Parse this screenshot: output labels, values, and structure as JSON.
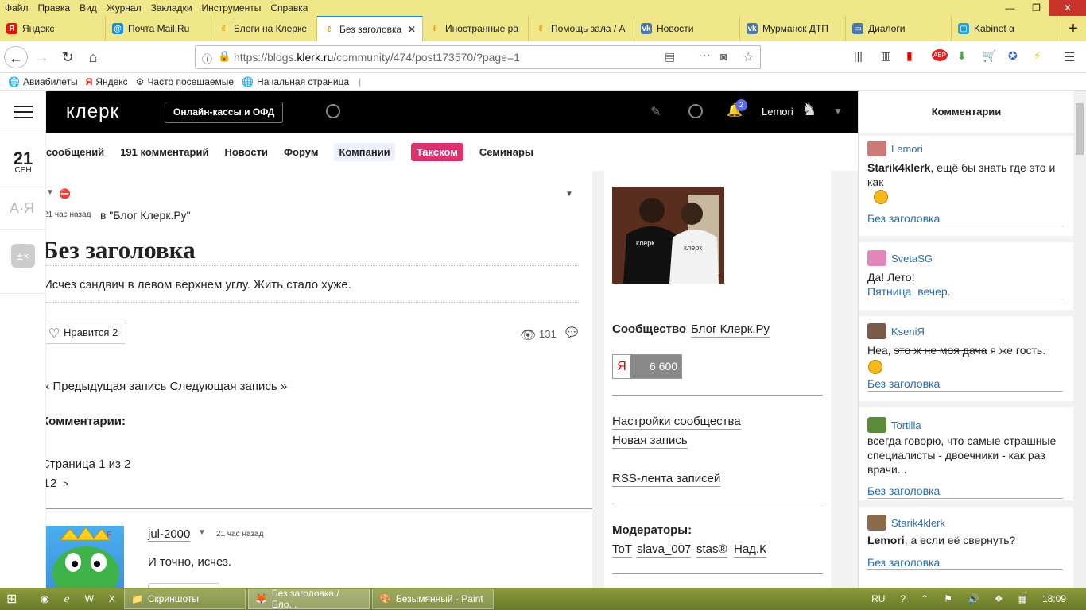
{
  "menubar": [
    "Файл",
    "Правка",
    "Вид",
    "Журнал",
    "Закладки",
    "Инструменты",
    "Справка"
  ],
  "window_controls": [
    "—",
    "❐",
    "✕"
  ],
  "tabs": [
    {
      "label": "Яндекс",
      "icon": "yandex-icon",
      "color": "#e61400"
    },
    {
      "label": "Почта Mail.Ru",
      "icon": "mail-icon",
      "color": "#168de2"
    },
    {
      "label": "Блоги на Клерке",
      "icon": "klerk-icon",
      "color": "#e8a21a"
    },
    {
      "label": "Без заголовка",
      "icon": "klerk-icon",
      "color": "#e8a21a"
    },
    {
      "label": "Иностранные ра",
      "icon": "klerk-icon",
      "color": "#e8a21a"
    },
    {
      "label": "Помощь зала / А",
      "icon": "klerk-icon",
      "color": "#e8a21a"
    },
    {
      "label": "Новости",
      "icon": "vk-icon",
      "color": "#4a76a8"
    },
    {
      "label": "Мурманск ДТП",
      "icon": "vk-icon",
      "color": "#4a76a8"
    },
    {
      "label": "Диалоги",
      "icon": "chat-icon",
      "color": "#4a76a8"
    },
    {
      "label": "Kabinet α",
      "icon": "kabinet-icon",
      "color": "#2a9fd6"
    }
  ],
  "new_tab": "+",
  "close_tab": "✕",
  "url": {
    "prefix": "https://blogs.",
    "host": "klerk.ru",
    "path": "/community/474/post173570/?page=1"
  },
  "bookmarks": [
    "Авиабилеты",
    "Яндекс",
    "Часто посещаемые",
    "Начальная страница"
  ],
  "rail": {
    "day": "21",
    "month": "СЕН",
    "az": "А·Я",
    "calc": "±×"
  },
  "header": {
    "logo": "клерк",
    "kassa": "Онлайн-кассы и ОФД",
    "notif_count": "2",
    "user": "Lemori"
  },
  "subnav": [
    "сообщений",
    "191 комментарий",
    "Новости",
    "Форум",
    "Компании",
    "Такском",
    "Семинары"
  ],
  "post": {
    "time": "21 час назад",
    "blog": "в \"Блог Клерк.Ру\"",
    "title": "Без заголовка",
    "body": "Исчез сэндвич в левом верхнем углу. Жить стало хуже.",
    "like_label": "Нравится",
    "like_count": "2",
    "views": "131",
    "nav": "« Предыдущая запись Следующая запись »",
    "comments_heading": "Комментарии:",
    "page_info": "Страница 1 из 2",
    "pages": [
      "1",
      "2",
      ">"
    ],
    "comment": {
      "user": "jul-2000",
      "time": "21 час назад",
      "text": "И точно, исчез."
    }
  },
  "sidebar": {
    "community_label": "Сообщество",
    "community_name": "Блог Клерк.Ру",
    "ya_letter": "Я",
    "ya_count": "6 600",
    "settings": "Настройки сообщества",
    "new_post": "Новая запись",
    "rss": "RSS-лента записей",
    "moderators_label": "Модераторы:",
    "moderators": [
      "ToT",
      "slava_007",
      "stas®",
      "Над.К"
    ]
  },
  "comments_panel": {
    "title": "Комментарии",
    "items": [
      {
        "user": "Lemori",
        "bold": "Starik4klerk",
        "text": ", ещё бы знать где это и как",
        "link": "Без заголовка",
        "avatar": "#c97a7a"
      },
      {
        "user": "SvetaSG",
        "text": "Да! Лето!",
        "text2": "Пятница, вечер.",
        "link": "",
        "avatar": "#e088b8"
      },
      {
        "user": "KseniЯ",
        "text": "Неа,",
        "strike": "это ж не моя дача",
        "text3": "я же гость.",
        "link": "Без заголовка",
        "avatar": "#7a5a4a"
      },
      {
        "user": "Tortilla",
        "text": "всегда говорю, что самые страшные специалисты - двоечники - как раз врачи...",
        "link": "Без заголовка",
        "avatar": "#5a8a3a"
      },
      {
        "user": "Starik4klerk",
        "bold": "Lemori",
        "text": ", а если её свернуть?",
        "link": "Без заголовка",
        "avatar": "#8a6a4a"
      }
    ]
  },
  "taskbar": {
    "apps": [
      "Скриншоты",
      "Без заголовка / Бло...",
      "Безымянный - Paint"
    ],
    "lang": "RU",
    "time": "18:09"
  }
}
